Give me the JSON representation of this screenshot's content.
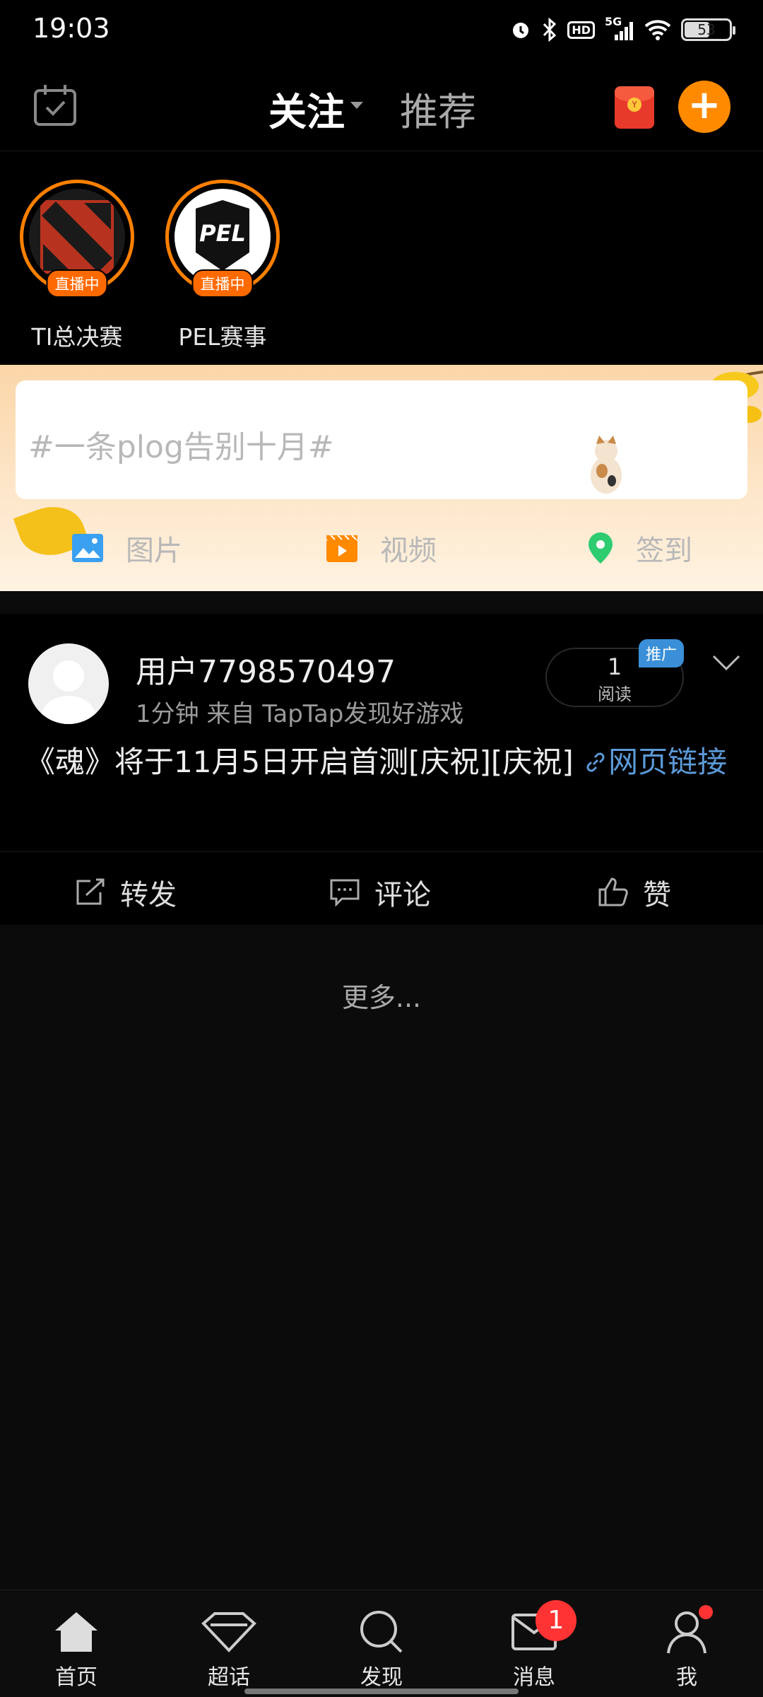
{
  "status_bar": {
    "time": "19:03",
    "network": "5G",
    "hd": "HD",
    "battery": "53"
  },
  "top_nav": {
    "tab_follow": "关注",
    "tab_recommend": "推荐"
  },
  "live": [
    {
      "name": "TI总决赛",
      "badge": "直播中",
      "logo": "dota2-logo"
    },
    {
      "name": "PEL赛事",
      "badge": "直播中",
      "logo": "pel-logo",
      "logo_text": "PEL"
    }
  ],
  "compose": {
    "placeholder": "#一条plog告别十月#",
    "actions": [
      {
        "label": "图片",
        "icon": "image-icon",
        "color": "#3aa0f0"
      },
      {
        "label": "视频",
        "icon": "video-icon",
        "color": "#ff8a00"
      },
      {
        "label": "签到",
        "icon": "location-pin-icon",
        "color": "#2ecc71"
      }
    ]
  },
  "post": {
    "username": "用户7798570497",
    "meta": "1分钟  来自  TapTap发现好游戏",
    "read_count": "1",
    "read_label": "阅读",
    "promo": "推广",
    "text": "《魂》将于11月5日开启首测[庆祝][庆祝] ",
    "link_text": "网页链接",
    "actions": {
      "repost": "转发",
      "comment": "评论",
      "like": "赞"
    }
  },
  "more": "更多...",
  "bottom_nav": [
    {
      "label": "首页",
      "icon": "home-icon"
    },
    {
      "label": "超话",
      "icon": "diamond-icon"
    },
    {
      "label": "发现",
      "icon": "search-icon"
    },
    {
      "label": "消息",
      "icon": "mail-icon",
      "badge": "1"
    },
    {
      "label": "我",
      "icon": "profile-icon"
    }
  ]
}
